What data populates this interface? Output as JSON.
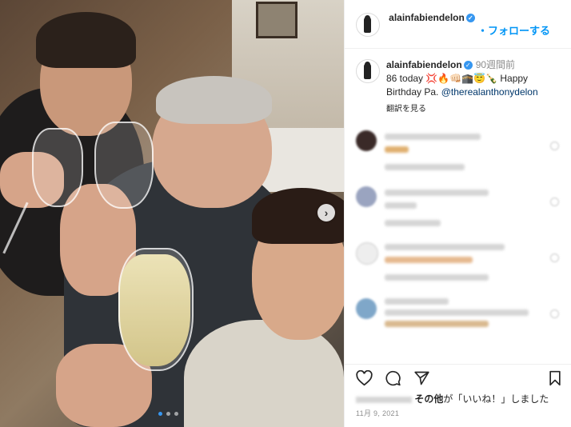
{
  "header": {
    "username": "alainfabiendelon",
    "follow_label": "・フォローする",
    "verified_mark": "✓"
  },
  "caption": {
    "username": "alainfabiendelon",
    "time": "90週間前",
    "text_start": "86 today 💢🔥👊🏻🕋😇🍾 Happy Birthday Pa. ",
    "mention": "@therealanthonydelon",
    "translate_label": "翻訳を見る"
  },
  "actions": {
    "like_icon": "heart-icon",
    "comment_icon": "comment-icon",
    "share_icon": "share-icon",
    "save_icon": "bookmark-icon"
  },
  "likes": {
    "text_bold1": "その他",
    "text_rest": "が「いいね！」しました"
  },
  "date": "11月 9, 2021",
  "photo": {
    "next_symbol": "›",
    "carousel_count": 3,
    "carousel_active": 1
  },
  "colors": {
    "accent": "#0095f6",
    "verified": "#3797f0",
    "mention": "#00376b"
  }
}
